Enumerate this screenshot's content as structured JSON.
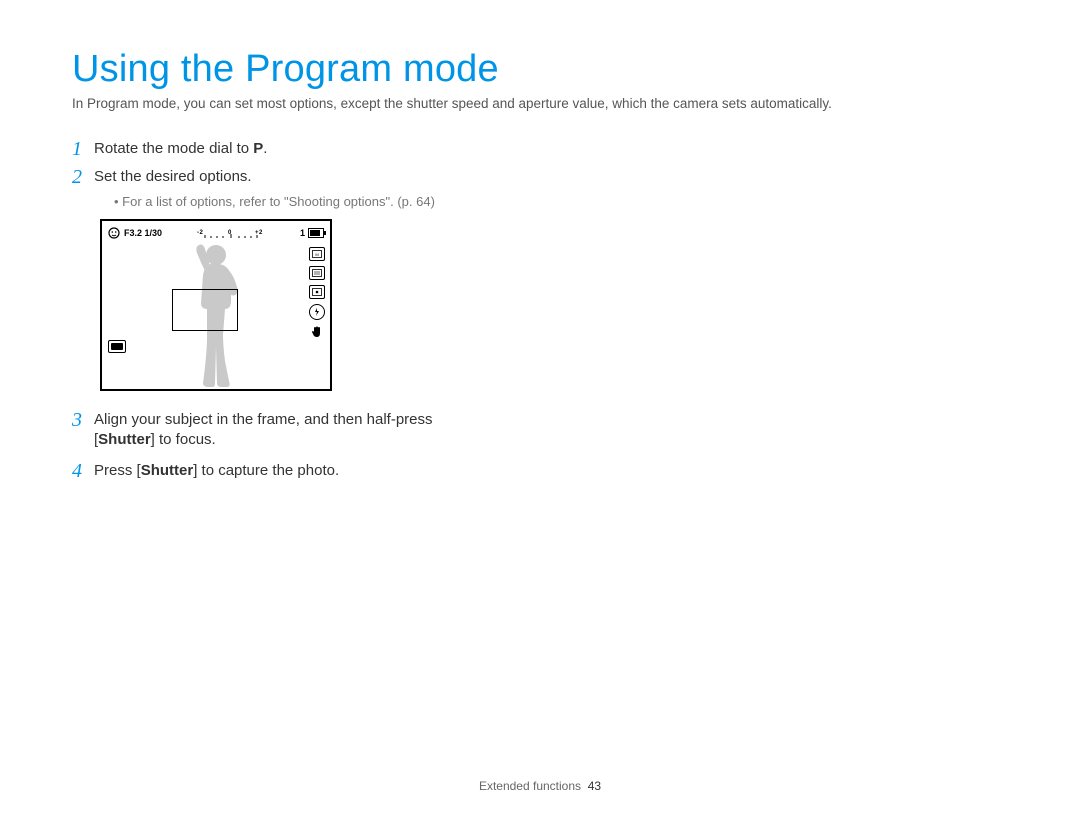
{
  "title": "Using the Program mode",
  "intro": "In Program mode, you can set most options, except the shutter speed and aperture value, which the camera sets automatically.",
  "steps": {
    "s1": {
      "num": "1",
      "text_pre": "Rotate the mode dial to ",
      "icon": "P",
      "text_post": "."
    },
    "s2": {
      "num": "2",
      "text": "Set the desired options.",
      "bullet": "For a list of options, refer to \"Shooting options\". (p. 64)"
    },
    "s3": {
      "num": "3",
      "line1_pre": "Align your subject in the frame, and then half-press",
      "line2_pre": "[",
      "line2_bold": "Shutter",
      "line2_post": "] to focus."
    },
    "s4": {
      "num": "4",
      "pre": "Press [",
      "bold": "Shutter",
      "post": "] to capture the photo."
    }
  },
  "lcd": {
    "aperture_shutter": "F3.2 1/30",
    "ev_scale": "-2…-1…0…+1…+2",
    "shots_remaining": "1",
    "right_icons": [
      "resolution-icon",
      "quality-icon",
      "metering-icon",
      "flash-off-icon",
      "ois-icon"
    ]
  },
  "footer": {
    "section": "Extended functions",
    "page": "43"
  }
}
